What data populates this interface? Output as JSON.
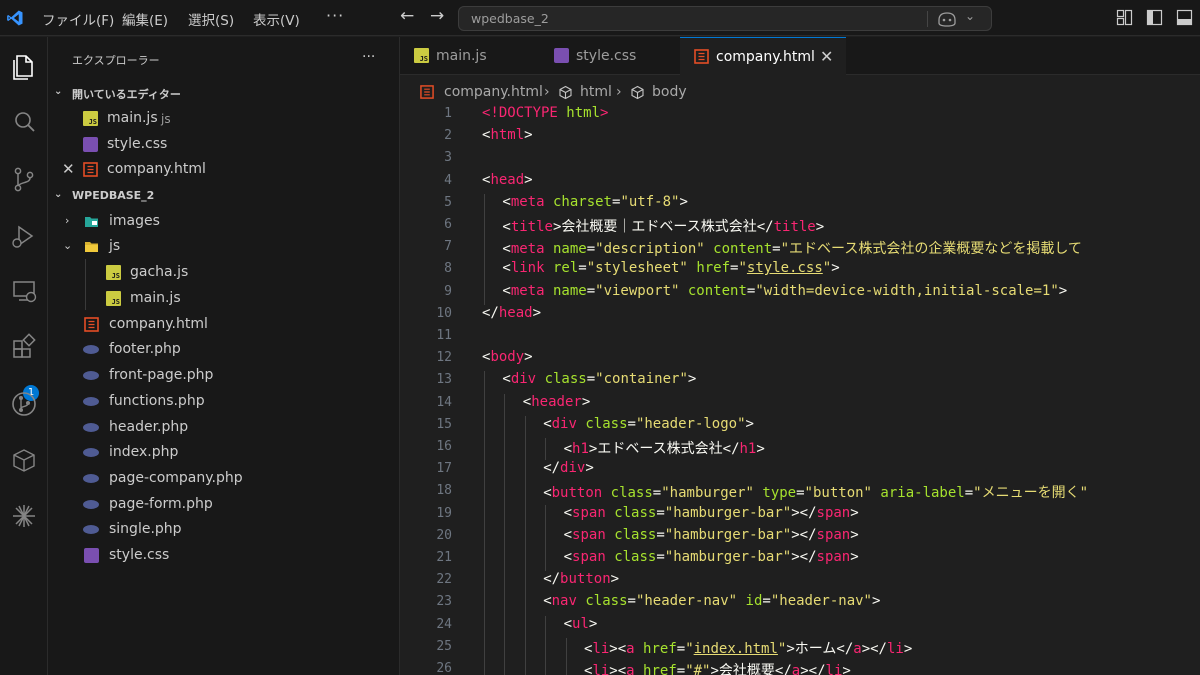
{
  "titlebar": {
    "menu": [
      "ファイル(F)",
      "編集(E)",
      "選択(S)",
      "表示(V)"
    ],
    "more": "···",
    "search_text": "wpedbase_2"
  },
  "activity": {
    "items": [
      "explorer-icon",
      "search-icon",
      "source-control-icon",
      "run-debug-icon",
      "remote-explorer-icon",
      "extensions-icon",
      "gitlens-icon",
      "packages-icon",
      "copilot-icon"
    ],
    "extensions_badge": "1"
  },
  "sidebar": {
    "title": "エクスプローラー",
    "more": "···",
    "open_editors_title": "開いているエディター",
    "open_editors": [
      {
        "name": "main.js",
        "desc": "js",
        "type": "js"
      },
      {
        "name": "style.css",
        "desc": "",
        "type": "css"
      },
      {
        "name": "company.html",
        "desc": "",
        "type": "html"
      }
    ],
    "workspace_title": "WPEDBASE_2",
    "tree": [
      {
        "name": "images",
        "type": "folder-images",
        "depth": 0,
        "expanded": false
      },
      {
        "name": "js",
        "type": "folder-js",
        "depth": 0,
        "expanded": true
      },
      {
        "name": "gacha.js",
        "type": "js",
        "depth": 1
      },
      {
        "name": "main.js",
        "type": "js",
        "depth": 1
      },
      {
        "name": "company.html",
        "type": "html",
        "depth": 0
      },
      {
        "name": "footer.php",
        "type": "php",
        "depth": 0
      },
      {
        "name": "front-page.php",
        "type": "php",
        "depth": 0
      },
      {
        "name": "functions.php",
        "type": "php",
        "depth": 0
      },
      {
        "name": "header.php",
        "type": "php",
        "depth": 0
      },
      {
        "name": "index.php",
        "type": "php",
        "depth": 0
      },
      {
        "name": "page-company.php",
        "type": "php",
        "depth": 0
      },
      {
        "name": "page-form.php",
        "type": "php",
        "depth": 0
      },
      {
        "name": "single.php",
        "type": "php",
        "depth": 0
      },
      {
        "name": "style.css",
        "type": "css",
        "depth": 0
      }
    ]
  },
  "editor": {
    "tabs": [
      {
        "label": "main.js",
        "type": "js",
        "active": false
      },
      {
        "label": "style.css",
        "type": "css",
        "active": false
      },
      {
        "label": "company.html",
        "type": "html",
        "active": true
      }
    ],
    "breadcrumb": [
      "company.html",
      "html",
      "body"
    ],
    "lines": [
      {
        "n": "1",
        "indent": 0,
        "tokens": [
          [
            "doc",
            "<!DOCTYPE "
          ],
          [
            "attr",
            "html"
          ],
          [
            "doc",
            ">"
          ]
        ]
      },
      {
        "n": "2",
        "indent": 0,
        "tokens": [
          [
            "pun",
            "<"
          ],
          [
            "tag",
            "html"
          ],
          [
            "pun",
            ">"
          ]
        ]
      },
      {
        "n": "3",
        "indent": 0,
        "tokens": []
      },
      {
        "n": "4",
        "indent": 0,
        "tokens": [
          [
            "pun",
            "<"
          ],
          [
            "tag",
            "head"
          ],
          [
            "pun",
            ">"
          ]
        ]
      },
      {
        "n": "5",
        "indent": 1,
        "tokens": [
          [
            "pun",
            "<"
          ],
          [
            "tag",
            "meta"
          ],
          [
            "txt",
            " "
          ],
          [
            "attr",
            "charset"
          ],
          [
            "pun",
            "="
          ],
          [
            "str",
            "\"utf-8\""
          ],
          [
            "pun",
            ">"
          ]
        ]
      },
      {
        "n": "6",
        "indent": 1,
        "tokens": [
          [
            "pun",
            "<"
          ],
          [
            "tag",
            "title"
          ],
          [
            "pun",
            ">"
          ],
          [
            "txt",
            "会社概要｜エドベース株式会社"
          ],
          [
            "pun",
            "</"
          ],
          [
            "tag",
            "title"
          ],
          [
            "pun",
            ">"
          ]
        ]
      },
      {
        "n": "7",
        "indent": 1,
        "tokens": [
          [
            "pun",
            "<"
          ],
          [
            "tag",
            "meta"
          ],
          [
            "txt",
            " "
          ],
          [
            "attr",
            "name"
          ],
          [
            "pun",
            "="
          ],
          [
            "str",
            "\"description\""
          ],
          [
            "txt",
            " "
          ],
          [
            "attr",
            "content"
          ],
          [
            "pun",
            "="
          ],
          [
            "str",
            "\"エドベース株式会社の企業概要などを掲載して"
          ]
        ]
      },
      {
        "n": "8",
        "indent": 1,
        "tokens": [
          [
            "pun",
            "<"
          ],
          [
            "tag",
            "link"
          ],
          [
            "txt",
            " "
          ],
          [
            "attr",
            "rel"
          ],
          [
            "pun",
            "="
          ],
          [
            "str",
            "\"stylesheet\""
          ],
          [
            "txt",
            " "
          ],
          [
            "attr",
            "href"
          ],
          [
            "pun",
            "="
          ],
          [
            "str",
            "\""
          ],
          [
            "link",
            "style.css"
          ],
          [
            "str",
            "\""
          ],
          [
            "pun",
            ">"
          ]
        ]
      },
      {
        "n": "9",
        "indent": 1,
        "tokens": [
          [
            "pun",
            "<"
          ],
          [
            "tag",
            "meta"
          ],
          [
            "txt",
            " "
          ],
          [
            "attr",
            "name"
          ],
          [
            "pun",
            "="
          ],
          [
            "str",
            "\"viewport\""
          ],
          [
            "txt",
            " "
          ],
          [
            "attr",
            "content"
          ],
          [
            "pun",
            "="
          ],
          [
            "str",
            "\"width=device-width,initial-scale=1\""
          ],
          [
            "pun",
            ">"
          ]
        ]
      },
      {
        "n": "10",
        "indent": 0,
        "tokens": [
          [
            "pun",
            "</"
          ],
          [
            "tag",
            "head"
          ],
          [
            "pun",
            ">"
          ]
        ]
      },
      {
        "n": "11",
        "indent": 0,
        "tokens": []
      },
      {
        "n": "12",
        "indent": 0,
        "tokens": [
          [
            "pun",
            "<"
          ],
          [
            "tag",
            "body"
          ],
          [
            "pun",
            ">"
          ]
        ]
      },
      {
        "n": "13",
        "indent": 1,
        "tokens": [
          [
            "pun",
            "<"
          ],
          [
            "tag",
            "div"
          ],
          [
            "txt",
            " "
          ],
          [
            "attr",
            "class"
          ],
          [
            "pun",
            "="
          ],
          [
            "str",
            "\"container\""
          ],
          [
            "pun",
            ">"
          ]
        ]
      },
      {
        "n": "14",
        "indent": 2,
        "tokens": [
          [
            "pun",
            "<"
          ],
          [
            "tag",
            "header"
          ],
          [
            "pun",
            ">"
          ]
        ]
      },
      {
        "n": "15",
        "indent": 3,
        "tokens": [
          [
            "pun",
            "<"
          ],
          [
            "tag",
            "div"
          ],
          [
            "txt",
            " "
          ],
          [
            "attr",
            "class"
          ],
          [
            "pun",
            "="
          ],
          [
            "str",
            "\"header-logo\""
          ],
          [
            "pun",
            ">"
          ]
        ]
      },
      {
        "n": "16",
        "indent": 4,
        "tokens": [
          [
            "pun",
            "<"
          ],
          [
            "tag",
            "h1"
          ],
          [
            "pun",
            ">"
          ],
          [
            "txt",
            "エドベース株式会社"
          ],
          [
            "pun",
            "</"
          ],
          [
            "tag",
            "h1"
          ],
          [
            "pun",
            ">"
          ]
        ]
      },
      {
        "n": "17",
        "indent": 3,
        "tokens": [
          [
            "pun",
            "</"
          ],
          [
            "tag",
            "div"
          ],
          [
            "pun",
            ">"
          ]
        ]
      },
      {
        "n": "18",
        "indent": 3,
        "tokens": [
          [
            "pun",
            "<"
          ],
          [
            "tag",
            "button"
          ],
          [
            "txt",
            " "
          ],
          [
            "attr",
            "class"
          ],
          [
            "pun",
            "="
          ],
          [
            "str",
            "\"hamburger\""
          ],
          [
            "txt",
            " "
          ],
          [
            "attr",
            "type"
          ],
          [
            "pun",
            "="
          ],
          [
            "str",
            "\"button\""
          ],
          [
            "txt",
            " "
          ],
          [
            "attr",
            "aria-label"
          ],
          [
            "pun",
            "="
          ],
          [
            "str",
            "\"メニューを開く\""
          ]
        ]
      },
      {
        "n": "19",
        "indent": 4,
        "tokens": [
          [
            "pun",
            "<"
          ],
          [
            "tag",
            "span"
          ],
          [
            "txt",
            " "
          ],
          [
            "attr",
            "class"
          ],
          [
            "pun",
            "="
          ],
          [
            "str",
            "\"hamburger-bar\""
          ],
          [
            "pun",
            "></"
          ],
          [
            "tag",
            "span"
          ],
          [
            "pun",
            ">"
          ]
        ]
      },
      {
        "n": "20",
        "indent": 4,
        "tokens": [
          [
            "pun",
            "<"
          ],
          [
            "tag",
            "span"
          ],
          [
            "txt",
            " "
          ],
          [
            "attr",
            "class"
          ],
          [
            "pun",
            "="
          ],
          [
            "str",
            "\"hamburger-bar\""
          ],
          [
            "pun",
            "></"
          ],
          [
            "tag",
            "span"
          ],
          [
            "pun",
            ">"
          ]
        ]
      },
      {
        "n": "21",
        "indent": 4,
        "tokens": [
          [
            "pun",
            "<"
          ],
          [
            "tag",
            "span"
          ],
          [
            "txt",
            " "
          ],
          [
            "attr",
            "class"
          ],
          [
            "pun",
            "="
          ],
          [
            "str",
            "\"hamburger-bar\""
          ],
          [
            "pun",
            "></"
          ],
          [
            "tag",
            "span"
          ],
          [
            "pun",
            ">"
          ]
        ]
      },
      {
        "n": "22",
        "indent": 3,
        "tokens": [
          [
            "pun",
            "</"
          ],
          [
            "tag",
            "button"
          ],
          [
            "pun",
            ">"
          ]
        ]
      },
      {
        "n": "23",
        "indent": 3,
        "tokens": [
          [
            "pun",
            "<"
          ],
          [
            "tag",
            "nav"
          ],
          [
            "txt",
            " "
          ],
          [
            "attr",
            "class"
          ],
          [
            "pun",
            "="
          ],
          [
            "str",
            "\"header-nav\""
          ],
          [
            "txt",
            " "
          ],
          [
            "attr",
            "id"
          ],
          [
            "pun",
            "="
          ],
          [
            "str",
            "\"header-nav\""
          ],
          [
            "pun",
            ">"
          ]
        ]
      },
      {
        "n": "24",
        "indent": 4,
        "tokens": [
          [
            "pun",
            "<"
          ],
          [
            "tag",
            "ul"
          ],
          [
            "pun",
            ">"
          ]
        ]
      },
      {
        "n": "25",
        "indent": 5,
        "tokens": [
          [
            "pun",
            "<"
          ],
          [
            "tag",
            "li"
          ],
          [
            "pun",
            "><"
          ],
          [
            "tag",
            "a"
          ],
          [
            "txt",
            " "
          ],
          [
            "attr",
            "href"
          ],
          [
            "pun",
            "="
          ],
          [
            "str",
            "\""
          ],
          [
            "link",
            "index.html"
          ],
          [
            "str",
            "\""
          ],
          [
            "pun",
            ">"
          ],
          [
            "txt",
            "ホーム"
          ],
          [
            "pun",
            "</"
          ],
          [
            "tag",
            "a"
          ],
          [
            "pun",
            "></"
          ],
          [
            "tag",
            "li"
          ],
          [
            "pun",
            ">"
          ]
        ]
      },
      {
        "n": "26",
        "indent": 5,
        "tokens": [
          [
            "pun",
            "<"
          ],
          [
            "tag",
            "li"
          ],
          [
            "pun",
            "><"
          ],
          [
            "tag",
            "a"
          ],
          [
            "txt",
            " "
          ],
          [
            "attr",
            "href"
          ],
          [
            "pun",
            "="
          ],
          [
            "str",
            "\"#\""
          ],
          [
            "pun",
            ">"
          ],
          [
            "txt",
            "会社概要"
          ],
          [
            "pun",
            "</"
          ],
          [
            "tag",
            "a"
          ],
          [
            "pun",
            "></"
          ],
          [
            "tag",
            "li"
          ],
          [
            "pun",
            ">"
          ]
        ]
      }
    ]
  },
  "colors": {
    "accent": "#0078d4",
    "tag": "#f92672",
    "attribute": "#a6e22e",
    "string": "#e6db74",
    "html_icon": "#e44d26",
    "js_icon": "#cbcb41",
    "css_icon": "#7a4fb1",
    "php_icon": "#4f5b93"
  }
}
